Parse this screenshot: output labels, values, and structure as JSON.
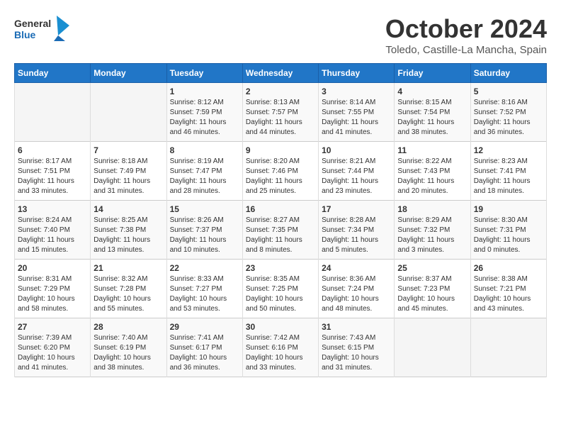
{
  "header": {
    "logo_line1": "General",
    "logo_line2": "Blue",
    "month": "October 2024",
    "location": "Toledo, Castille-La Mancha, Spain"
  },
  "weekdays": [
    "Sunday",
    "Monday",
    "Tuesday",
    "Wednesday",
    "Thursday",
    "Friday",
    "Saturday"
  ],
  "weeks": [
    [
      {
        "day": "",
        "info": ""
      },
      {
        "day": "",
        "info": ""
      },
      {
        "day": "1",
        "info": "Sunrise: 8:12 AM\nSunset: 7:59 PM\nDaylight: 11 hours and 46 minutes."
      },
      {
        "day": "2",
        "info": "Sunrise: 8:13 AM\nSunset: 7:57 PM\nDaylight: 11 hours and 44 minutes."
      },
      {
        "day": "3",
        "info": "Sunrise: 8:14 AM\nSunset: 7:55 PM\nDaylight: 11 hours and 41 minutes."
      },
      {
        "day": "4",
        "info": "Sunrise: 8:15 AM\nSunset: 7:54 PM\nDaylight: 11 hours and 38 minutes."
      },
      {
        "day": "5",
        "info": "Sunrise: 8:16 AM\nSunset: 7:52 PM\nDaylight: 11 hours and 36 minutes."
      }
    ],
    [
      {
        "day": "6",
        "info": "Sunrise: 8:17 AM\nSunset: 7:51 PM\nDaylight: 11 hours and 33 minutes."
      },
      {
        "day": "7",
        "info": "Sunrise: 8:18 AM\nSunset: 7:49 PM\nDaylight: 11 hours and 31 minutes."
      },
      {
        "day": "8",
        "info": "Sunrise: 8:19 AM\nSunset: 7:47 PM\nDaylight: 11 hours and 28 minutes."
      },
      {
        "day": "9",
        "info": "Sunrise: 8:20 AM\nSunset: 7:46 PM\nDaylight: 11 hours and 25 minutes."
      },
      {
        "day": "10",
        "info": "Sunrise: 8:21 AM\nSunset: 7:44 PM\nDaylight: 11 hours and 23 minutes."
      },
      {
        "day": "11",
        "info": "Sunrise: 8:22 AM\nSunset: 7:43 PM\nDaylight: 11 hours and 20 minutes."
      },
      {
        "day": "12",
        "info": "Sunrise: 8:23 AM\nSunset: 7:41 PM\nDaylight: 11 hours and 18 minutes."
      }
    ],
    [
      {
        "day": "13",
        "info": "Sunrise: 8:24 AM\nSunset: 7:40 PM\nDaylight: 11 hours and 15 minutes."
      },
      {
        "day": "14",
        "info": "Sunrise: 8:25 AM\nSunset: 7:38 PM\nDaylight: 11 hours and 13 minutes."
      },
      {
        "day": "15",
        "info": "Sunrise: 8:26 AM\nSunset: 7:37 PM\nDaylight: 11 hours and 10 minutes."
      },
      {
        "day": "16",
        "info": "Sunrise: 8:27 AM\nSunset: 7:35 PM\nDaylight: 11 hours and 8 minutes."
      },
      {
        "day": "17",
        "info": "Sunrise: 8:28 AM\nSunset: 7:34 PM\nDaylight: 11 hours and 5 minutes."
      },
      {
        "day": "18",
        "info": "Sunrise: 8:29 AM\nSunset: 7:32 PM\nDaylight: 11 hours and 3 minutes."
      },
      {
        "day": "19",
        "info": "Sunrise: 8:30 AM\nSunset: 7:31 PM\nDaylight: 11 hours and 0 minutes."
      }
    ],
    [
      {
        "day": "20",
        "info": "Sunrise: 8:31 AM\nSunset: 7:29 PM\nDaylight: 10 hours and 58 minutes."
      },
      {
        "day": "21",
        "info": "Sunrise: 8:32 AM\nSunset: 7:28 PM\nDaylight: 10 hours and 55 minutes."
      },
      {
        "day": "22",
        "info": "Sunrise: 8:33 AM\nSunset: 7:27 PM\nDaylight: 10 hours and 53 minutes."
      },
      {
        "day": "23",
        "info": "Sunrise: 8:35 AM\nSunset: 7:25 PM\nDaylight: 10 hours and 50 minutes."
      },
      {
        "day": "24",
        "info": "Sunrise: 8:36 AM\nSunset: 7:24 PM\nDaylight: 10 hours and 48 minutes."
      },
      {
        "day": "25",
        "info": "Sunrise: 8:37 AM\nSunset: 7:23 PM\nDaylight: 10 hours and 45 minutes."
      },
      {
        "day": "26",
        "info": "Sunrise: 8:38 AM\nSunset: 7:21 PM\nDaylight: 10 hours and 43 minutes."
      }
    ],
    [
      {
        "day": "27",
        "info": "Sunrise: 7:39 AM\nSunset: 6:20 PM\nDaylight: 10 hours and 41 minutes."
      },
      {
        "day": "28",
        "info": "Sunrise: 7:40 AM\nSunset: 6:19 PM\nDaylight: 10 hours and 38 minutes."
      },
      {
        "day": "29",
        "info": "Sunrise: 7:41 AM\nSunset: 6:17 PM\nDaylight: 10 hours and 36 minutes."
      },
      {
        "day": "30",
        "info": "Sunrise: 7:42 AM\nSunset: 6:16 PM\nDaylight: 10 hours and 33 minutes."
      },
      {
        "day": "31",
        "info": "Sunrise: 7:43 AM\nSunset: 6:15 PM\nDaylight: 10 hours and 31 minutes."
      },
      {
        "day": "",
        "info": ""
      },
      {
        "day": "",
        "info": ""
      }
    ]
  ]
}
